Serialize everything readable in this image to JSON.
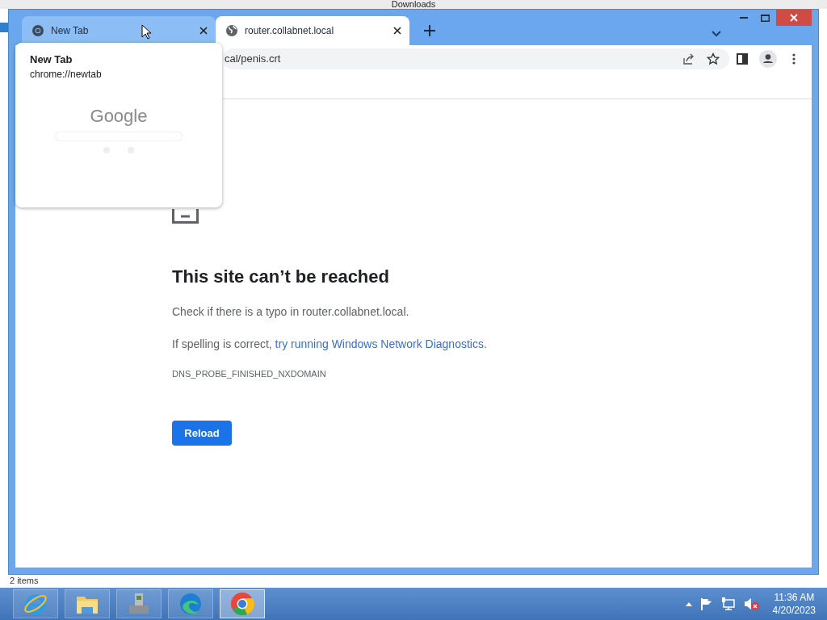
{
  "background_window": {
    "title": "Downloads",
    "status": "2 items"
  },
  "browser": {
    "tabs": [
      {
        "title": "New Tab",
        "kind": "chrome",
        "selected": false,
        "hovered": true
      },
      {
        "title": "router.collabnet.local",
        "kind": "globe",
        "selected": true,
        "hovered": false
      }
    ],
    "address": {
      "value": "cal/penis.crt"
    },
    "hover_card": {
      "title": "New Tab",
      "url": "chrome://newtab",
      "thumbnail_logo": "Google"
    },
    "error_page": {
      "heading": "This site can’t be reached",
      "line_1": "Check if there is a typo in router.collabnet.local.",
      "line_2": {
        "text": "If spelling is correct, ",
        "link": "try running Windows Network Diagnostics",
        "after": "."
      },
      "error_code": "DNS_PROBE_FINISHED_NXDOMAIN",
      "button": "Reload"
    }
  },
  "taskbar": {
    "apps": [
      {
        "kind": "ie",
        "selected": false
      },
      {
        "kind": "explorer",
        "selected": false
      },
      {
        "kind": "admin",
        "selected": false
      },
      {
        "kind": "edge",
        "selected": false
      },
      {
        "kind": "chrome",
        "selected": true
      }
    ],
    "clock": {
      "time": "11:36 AM",
      "date": "4/20/2023"
    }
  }
}
